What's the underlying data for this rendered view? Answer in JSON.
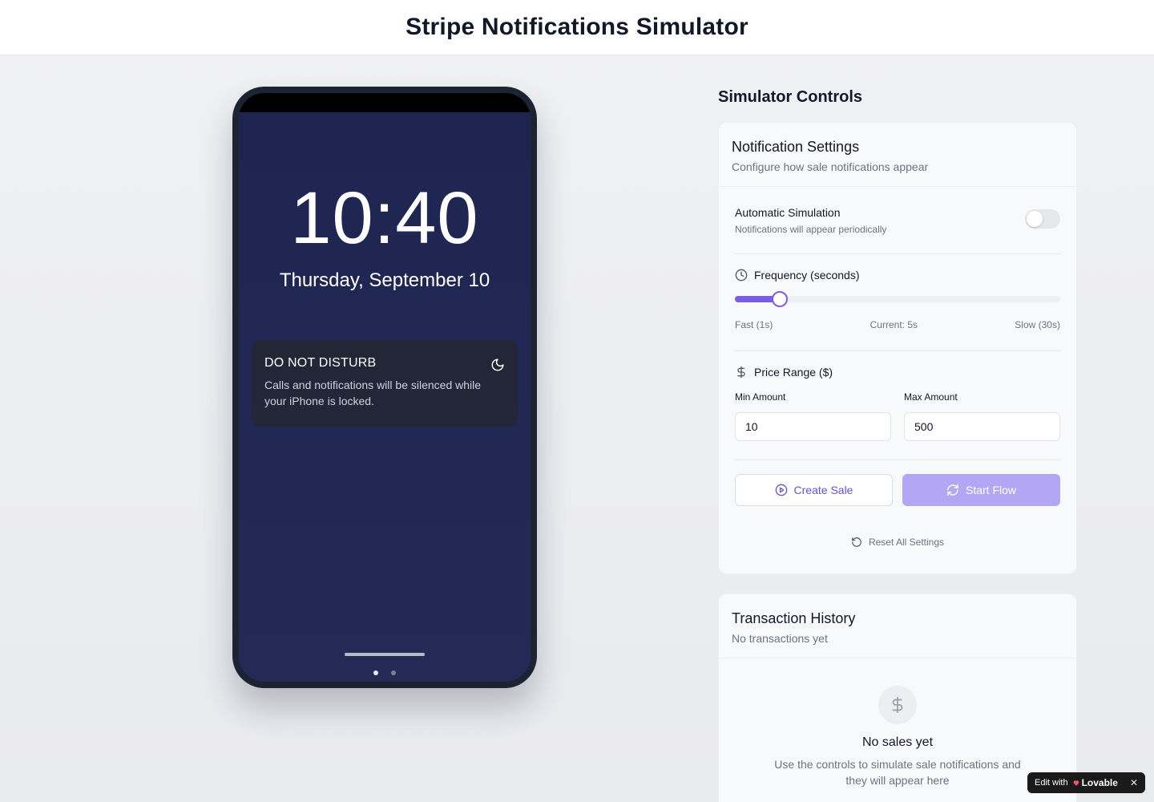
{
  "header": {
    "title": "Stripe Notifications Simulator"
  },
  "phone": {
    "time": "10:40",
    "date": "Thursday, September 10",
    "dnd": {
      "title": "DO NOT DISTURB",
      "text": "Calls and notifications will be silenced while your iPhone is locked.",
      "icon": "moon-icon"
    },
    "page_dots": {
      "count": 2,
      "active": 1
    }
  },
  "controls": {
    "title": "Simulator Controls",
    "settings": {
      "title": "Notification Settings",
      "subtitle": "Configure how sale notifications appear",
      "auto": {
        "title": "Automatic Simulation",
        "subtitle": "Notifications will appear periodically",
        "enabled": false
      },
      "frequency": {
        "label": "Frequency (seconds)",
        "icon": "clock-icon",
        "min": 1,
        "max": 30,
        "value": 5,
        "fast_label": "Fast (1s)",
        "current_label": "Current: 5s",
        "slow_label": "Slow (30s)"
      },
      "price": {
        "label": "Price Range ($)",
        "icon": "dollar-icon",
        "min_label": "Min Amount",
        "min_value": "10",
        "max_label": "Max Amount",
        "max_value": "500"
      },
      "create_label": "Create Sale",
      "flow_label": "Start Flow",
      "reset_label": "Reset All Settings"
    },
    "history": {
      "title": "Transaction History",
      "subtitle": "No transactions yet",
      "empty_title": "No sales yet",
      "empty_text": "Use the controls to simulate sale notifications and they will appear here"
    }
  },
  "badge": {
    "prefix": "Edit with",
    "brand": "Lovable",
    "close": "✕"
  },
  "colors": {
    "accent": "#7c5ce6",
    "accent_light": "#b3a7f5",
    "phone_screen": "#1e2550"
  }
}
